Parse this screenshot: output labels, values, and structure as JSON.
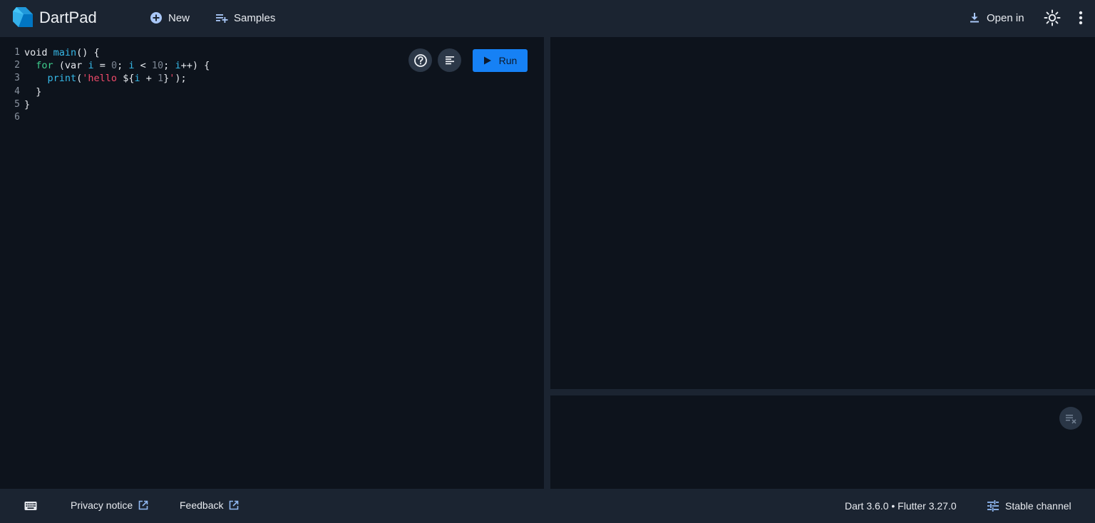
{
  "app": {
    "title": "DartPad",
    "colors": {
      "bar": "#1b2431",
      "background": "#0d131c",
      "accent": "#1681f5",
      "logo_light": "#45c4f5",
      "logo_dark": "#0175c2"
    }
  },
  "topbar": {
    "new_label": "New",
    "new_icon": "add-circle-icon",
    "samples_label": "Samples",
    "samples_icon": "playlist-add-icon",
    "open_in_label": "Open in",
    "open_in_icon": "download-icon",
    "theme_icon": "sun-icon",
    "more_icon": "more-vertical-icon"
  },
  "editor": {
    "line_numbers": [
      "1",
      "2",
      "3",
      "4",
      "5",
      "6"
    ],
    "code_lines": [
      "void main() {",
      "  for (var i = 0; i < 10; i++) {",
      "    print('hello ${i + 1}');",
      "  }",
      "}",
      ""
    ],
    "help_icon": "help-circle-icon",
    "format_icon": "format-align-icon",
    "run_label": "Run",
    "run_icon": "play-icon"
  },
  "console": {
    "clear_icon": "clear-all-icon"
  },
  "statusbar": {
    "keyboard_icon": "keyboard-icon",
    "privacy_label": "Privacy notice",
    "feedback_label": "Feedback",
    "external_icon": "open-in-new-icon",
    "version_text": "Dart 3.6.0 • Flutter 3.27.0",
    "channel_label": "Stable channel",
    "channel_icon": "tune-icon"
  }
}
